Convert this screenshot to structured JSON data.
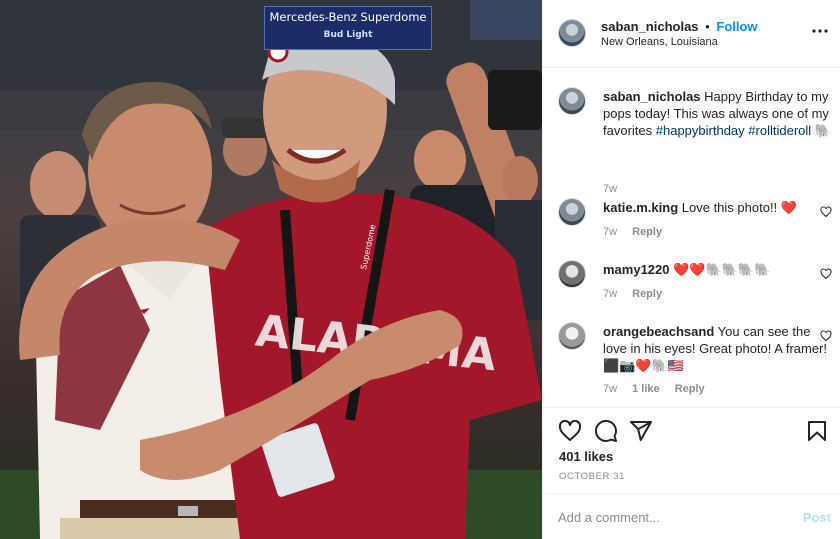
{
  "photo": {
    "arena_sign_title": "Mercedes-Benz Superdome",
    "arena_sign_sub": "Bud Light",
    "shirt_text": "ALABAMA",
    "lanyard_text": "Superdome"
  },
  "header": {
    "username": "saban_nicholas",
    "separator": "•",
    "follow_label": "Follow",
    "location": "New Orleans, Louisiana"
  },
  "caption": {
    "username": "saban_nicholas",
    "text": "Happy Birthday to my pops today! This was always one of my favorites",
    "hashtags": [
      "#happybirthday",
      "#rolltideroll"
    ],
    "emoji": "🐘",
    "time": "7w"
  },
  "comments": [
    {
      "username": "katie.m.king",
      "text": "Love this photo!! ❤️",
      "time": "7w",
      "likes": "",
      "reply_label": "Reply"
    },
    {
      "username": "mamy1220",
      "text": "❤️❤️🐘🐘🐘🐘",
      "time": "7w",
      "likes": "",
      "reply_label": "Reply"
    },
    {
      "username": "orangebeachsand",
      "text": "You can see the love in his eyes! Great photo! A framer! ⬛📷❤️🐘🇺🇸",
      "time": "7w",
      "likes": "1 like",
      "reply_label": "Reply"
    }
  ],
  "actions": {
    "likes": "401 likes",
    "date": "OCTOBER 31"
  },
  "add_comment": {
    "placeholder": "Add a comment...",
    "post_label": "Post"
  },
  "icons": {
    "more": "more-options-icon",
    "like": "heart-icon",
    "comment": "comment-icon",
    "share": "share-icon",
    "save": "bookmark-icon"
  },
  "colors": {
    "link_blue": "#0095f6",
    "hashtag": "#00376b",
    "muted": "#8e8e8e",
    "post_disabled": "#b2dffc",
    "crimson": "#a3172b"
  }
}
